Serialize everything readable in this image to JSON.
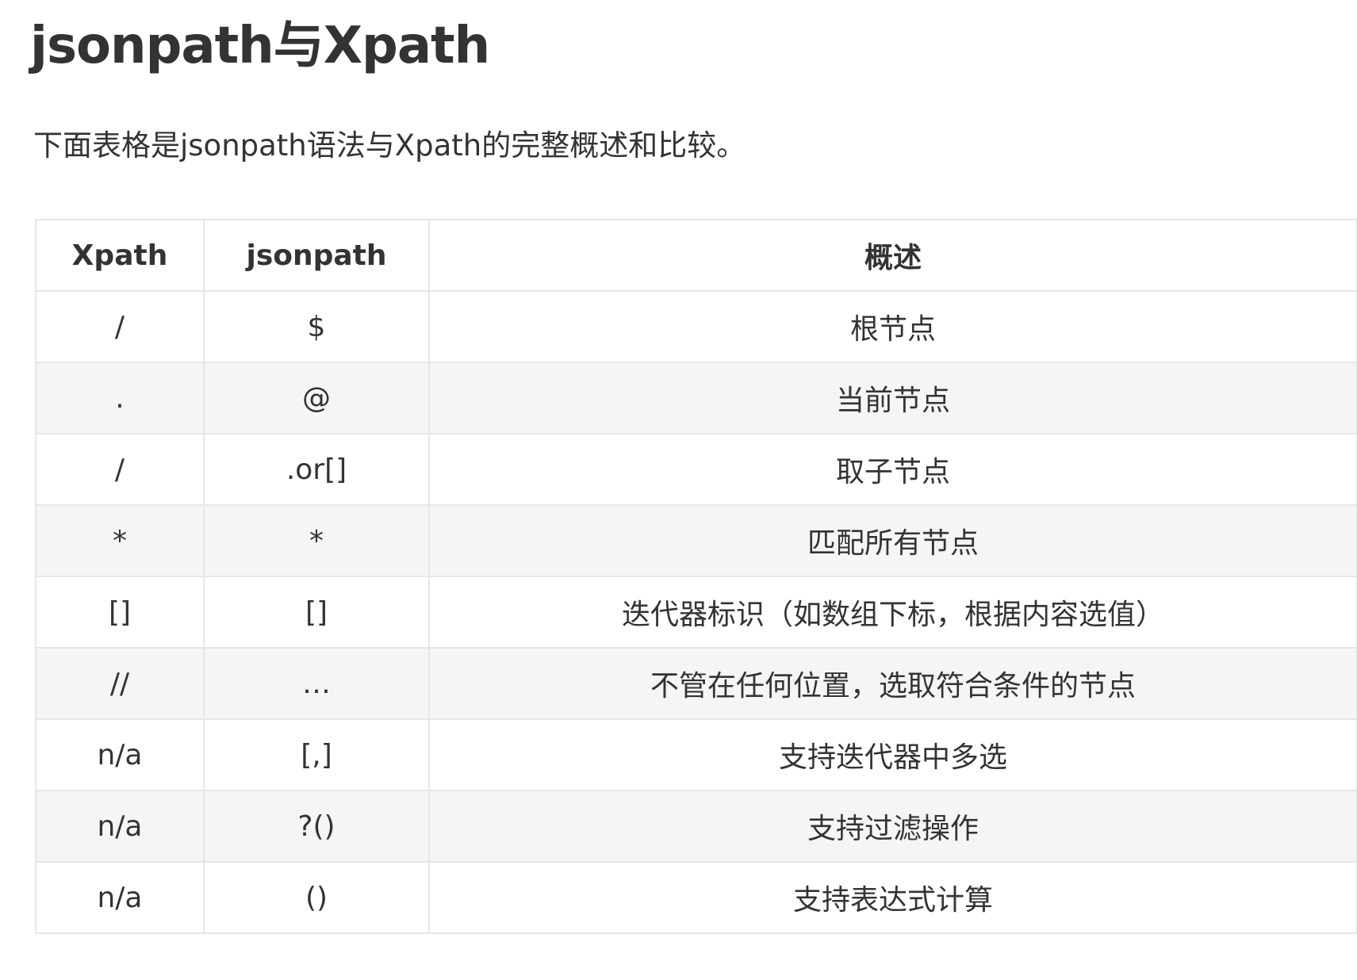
{
  "title": "jsonpath与Xpath",
  "intro": "下面表格是jsonpath语法与Xpath的完整概述和比较。",
  "table": {
    "headers": [
      "Xpath",
      "jsonpath",
      "概述"
    ],
    "rows": [
      [
        "/",
        "$",
        "根节点"
      ],
      [
        ".",
        "@",
        "当前节点"
      ],
      [
        "/",
        ".or[]",
        "取子节点"
      ],
      [
        "*",
        "*",
        "匹配所有节点"
      ],
      [
        "[]",
        "[]",
        "迭代器标识（如数组下标，根据内容选值）"
      ],
      [
        "//",
        "…",
        "不管在任何位置，选取符合条件的节点"
      ],
      [
        "n/a",
        "[,]",
        "支持迭代器中多选"
      ],
      [
        "n/a",
        "?()",
        "支持过滤操作"
      ],
      [
        "n/a",
        "()",
        "支持表达式计算"
      ]
    ]
  }
}
